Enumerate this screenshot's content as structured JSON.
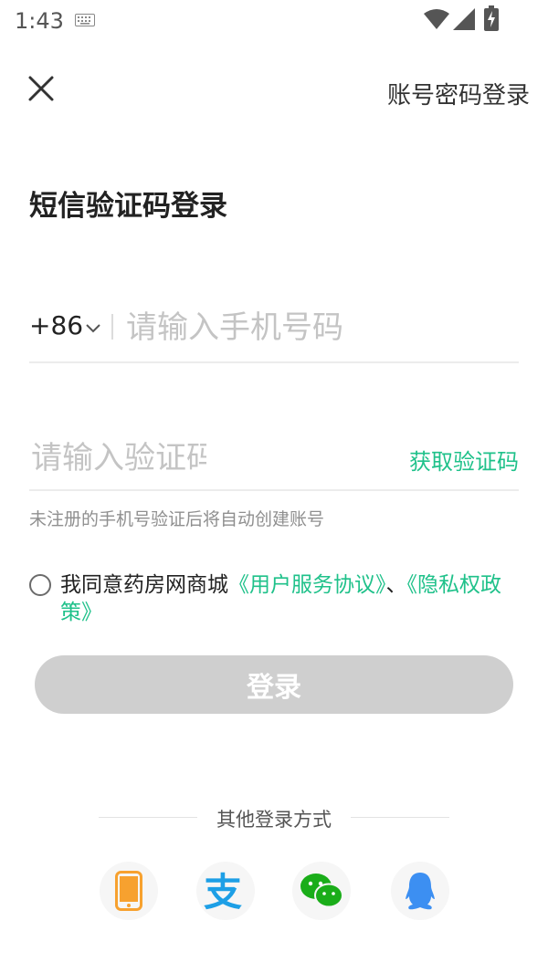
{
  "status_bar": {
    "time": "1:43"
  },
  "header": {
    "alt_login_label": "账号密码登录"
  },
  "title": "短信验证码登录",
  "phone": {
    "country_code": "+86",
    "placeholder": "请输入手机号码"
  },
  "code": {
    "placeholder": "请输入验证码",
    "get_code_label": "获取验证码"
  },
  "hint": "未注册的手机号验证后将自动创建账号",
  "agreement": {
    "prefix": "我同意药房网商城",
    "user_agreement": "《用户服务协议》",
    "separator": "、",
    "privacy_policy": "《隐私权政策》"
  },
  "login_button_label": "登录",
  "other_login": {
    "label": "其他登录方式",
    "methods": [
      "phone-icon",
      "alipay-icon",
      "wechat-icon",
      "qq-icon"
    ]
  },
  "colors": {
    "accent": "#1fc18a",
    "button_disabled": "#cfcfcf",
    "phone_icon": "#f7a12f",
    "alipay_icon": "#1d9fe6",
    "wechat_icon": "#1aad19",
    "qq_icon": "#3c8ff2"
  }
}
